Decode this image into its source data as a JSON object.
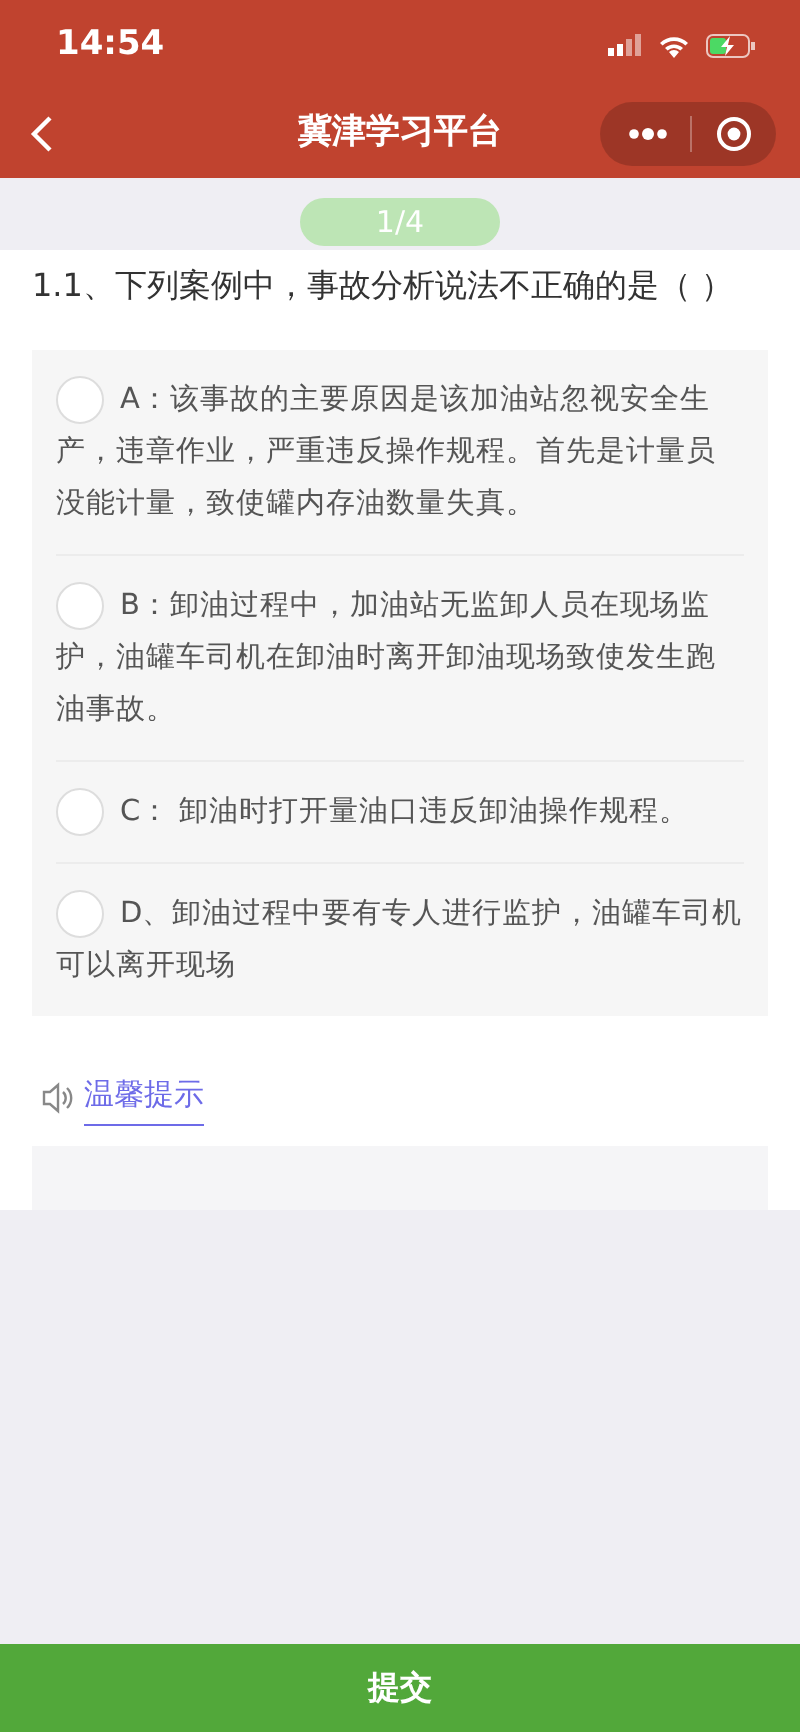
{
  "status_bar": {
    "time": "14:54"
  },
  "nav": {
    "title": "冀津学习平台"
  },
  "progress": {
    "label": "1/4"
  },
  "question": {
    "text": "1.1、下列案例中，事故分析说法不正确的是（ ）",
    "options": [
      {
        "text": "A：该事故的主要原因是该加油站忽视安全生产，违章作业，严重违反操作规程。首先是计量员没能计量，致使罐内存油数量失真。",
        "selected": false
      },
      {
        "text": "B：卸油过程中，加油站无监卸人员在现场监护，油罐车司机在卸油时离开卸油现场致使发生跑油事故。",
        "selected": false
      },
      {
        "text": "C：  卸油时打开量油口违反卸油操作规程。",
        "selected": false
      },
      {
        "text": "D、卸油过程中要有专人进行监护，油罐车司机可以离开现场",
        "selected": false
      }
    ]
  },
  "tip": {
    "label": "温馨提示"
  },
  "submit": {
    "label": "提交"
  }
}
